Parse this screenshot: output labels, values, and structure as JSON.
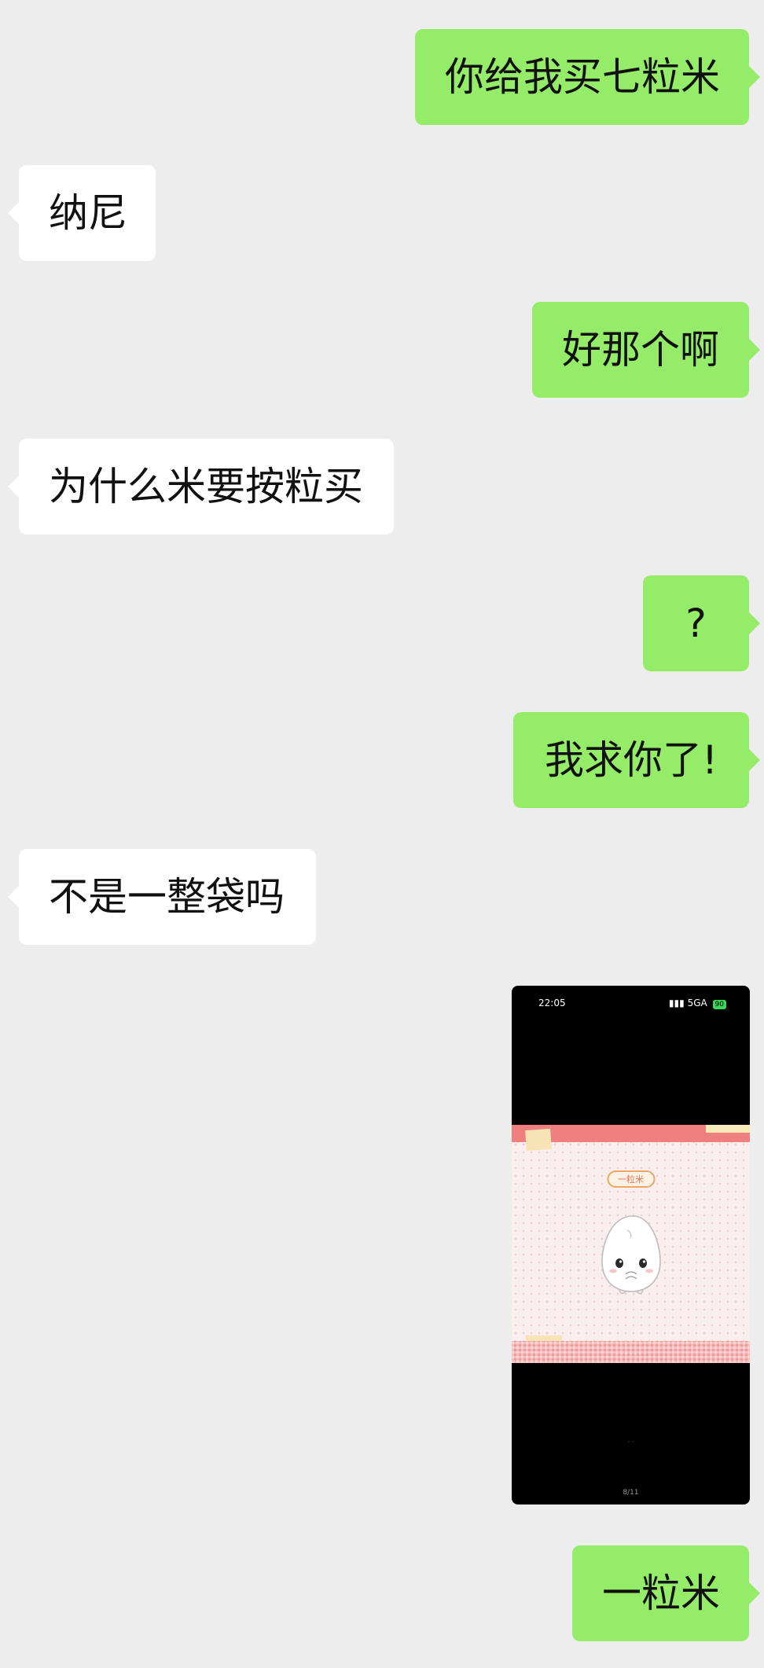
{
  "messages": [
    {
      "side": "sent",
      "text": "你给我买七粒米"
    },
    {
      "side": "received",
      "text": "纳尼"
    },
    {
      "side": "sent",
      "text": "好那个啊"
    },
    {
      "side": "received",
      "text": "为什么米要按粒买"
    },
    {
      "side": "sent",
      "text": "?"
    },
    {
      "side": "sent",
      "text": "我求你了!"
    },
    {
      "side": "received",
      "text": "不是一整袋吗"
    },
    {
      "side": "sent",
      "type": "image"
    },
    {
      "side": "sent",
      "text": "一粒米"
    }
  ],
  "screenshot": {
    "status_time": "22:05",
    "status_network": "5GA",
    "status_battery": "90",
    "card_label": "一粒米",
    "page_counter": "8/11"
  },
  "colors": {
    "background": "#ededed",
    "sent_bubble": "#95ec69",
    "received_bubble": "#ffffff",
    "text": "#111111"
  }
}
